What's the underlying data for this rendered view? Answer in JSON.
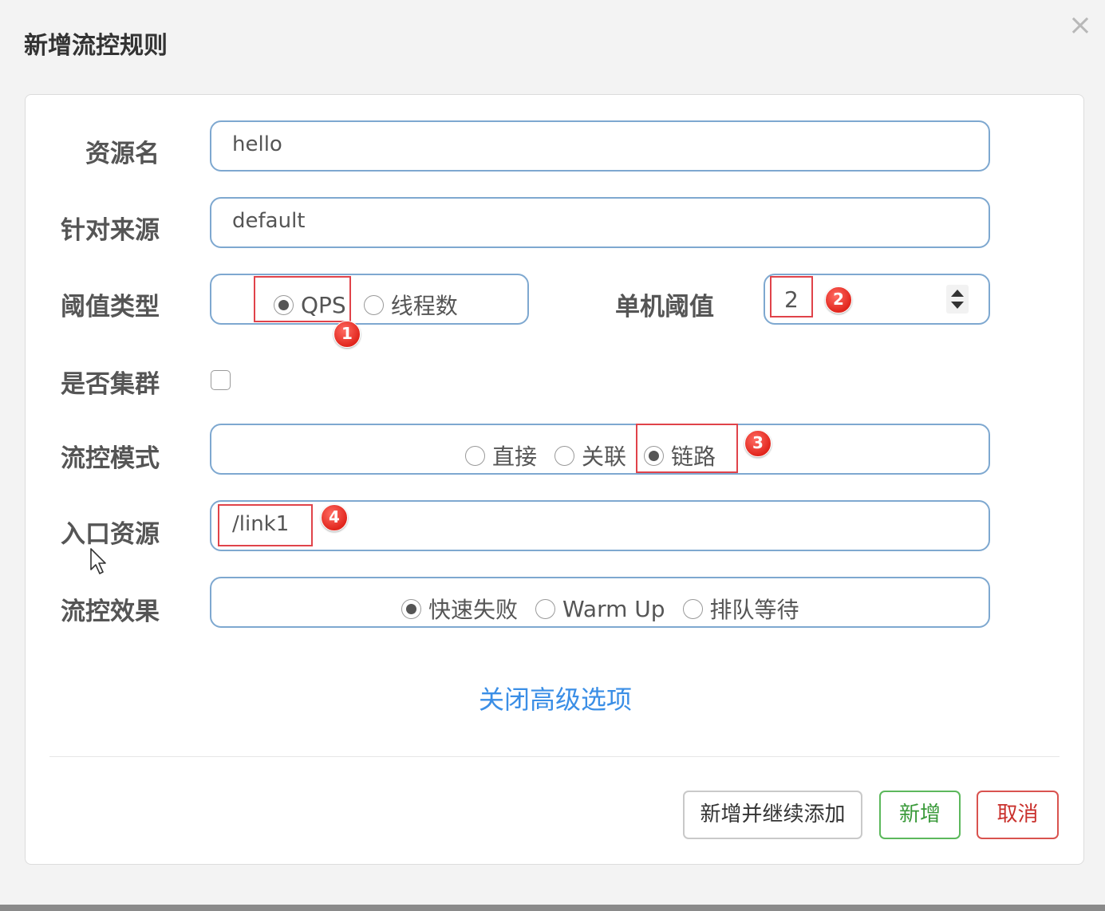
{
  "dialog": {
    "title": "新增流控规则"
  },
  "icons": {
    "close": "close-icon",
    "cursor": "mouse-pointer-icon",
    "spinner": "number-spinner-icon"
  },
  "form": {
    "resource_name": {
      "label": "资源名",
      "value": "hello"
    },
    "limit_app": {
      "label": "针对来源",
      "value": "default"
    },
    "grade": {
      "label": "阈值类型",
      "options": [
        {
          "label": "QPS",
          "checked": true
        },
        {
          "label": "线程数",
          "checked": false
        }
      ]
    },
    "count": {
      "label": "单机阈值",
      "value": "2"
    },
    "cluster": {
      "label": "是否集群",
      "checked": false
    },
    "strategy": {
      "label": "流控模式",
      "options": [
        {
          "label": "直接",
          "checked": false
        },
        {
          "label": "关联",
          "checked": false
        },
        {
          "label": "链路",
          "checked": true
        }
      ]
    },
    "ref_resource": {
      "label": "入口资源",
      "value": "/link1"
    },
    "control_behavior": {
      "label": "流控效果",
      "options": [
        {
          "label": "快速失败",
          "checked": true
        },
        {
          "label": "Warm Up",
          "checked": false
        },
        {
          "label": "排队等待",
          "checked": false
        }
      ]
    }
  },
  "advanced_toggle": "关闭高级选项",
  "annotations": [
    "1",
    "2",
    "3",
    "4"
  ],
  "buttons": {
    "add_continue": "新增并继续添加",
    "add": "新增",
    "cancel": "取消"
  },
  "colors": {
    "field_border": "#7ea8d0",
    "link": "#3a8ee6",
    "highlight": "#e0434a",
    "success": "#5cb85c",
    "danger": "#d9534f"
  }
}
